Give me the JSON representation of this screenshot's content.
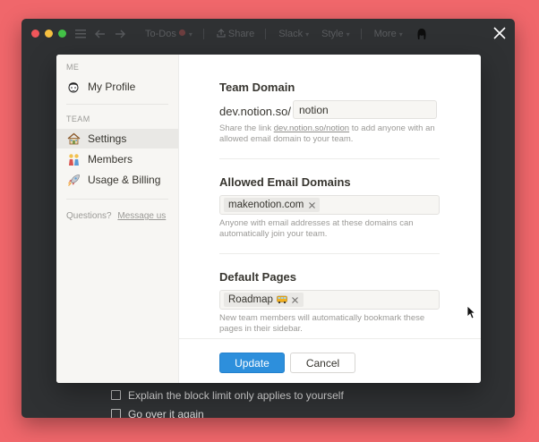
{
  "colors": {
    "background": "#f0676b",
    "window": "#2f3133",
    "accent": "#2d8fdc",
    "sidebar": "#f7f6f3"
  },
  "app_toolbar": {
    "page_title": "To-Dos",
    "share": "Share",
    "slack": "Slack",
    "style": "Style",
    "more": "More"
  },
  "background_list": {
    "items": [
      "Explain the block limit only applies to yourself",
      "Go over it again"
    ]
  },
  "sidebar": {
    "me_label": "ME",
    "team_label": "TEAM",
    "items": [
      {
        "label": "My Profile",
        "icon": "face-icon",
        "active": false
      },
      {
        "label": "Settings",
        "icon": "house-icon",
        "active": true
      },
      {
        "label": "Members",
        "icon": "people-icon",
        "active": false
      },
      {
        "label": "Usage & Billing",
        "icon": "rocket-icon",
        "active": false
      }
    ],
    "questions": "Questions?",
    "message_us": "Message us"
  },
  "team_domain": {
    "title": "Team Domain",
    "prefix": "dev.notion.so/",
    "value": "notion",
    "help_before": "Share the link ",
    "help_link": "dev.notion.so/notion",
    "help_after": " to add anyone with an allowed email domain to your team."
  },
  "allowed_email": {
    "title": "Allowed Email Domains",
    "tags": [
      "makenotion.com"
    ],
    "help": "Anyone with email addresses at these domains can automatically join your team."
  },
  "default_pages": {
    "title": "Default Pages",
    "tags": [
      "Roadmap"
    ],
    "help": "New team members will automatically bookmark these pages in their sidebar."
  },
  "buttons": {
    "update": "Update",
    "cancel": "Cancel"
  }
}
